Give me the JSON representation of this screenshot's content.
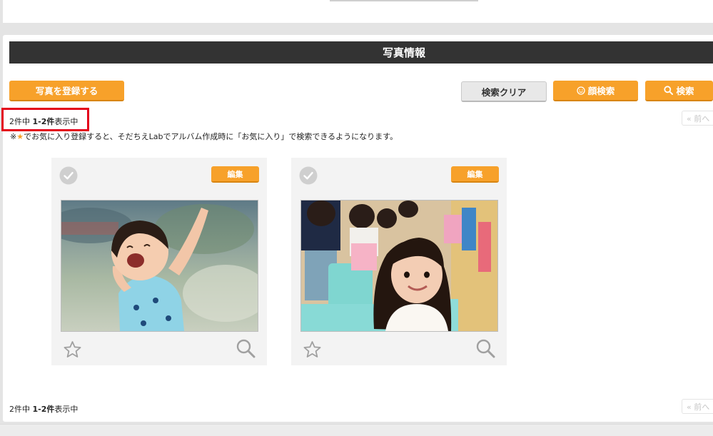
{
  "section": {
    "title": "写真情報"
  },
  "toolbar": {
    "register_label": "写真を登録する",
    "clear_label": "検索クリア",
    "face_search_label": "顔検索",
    "search_label": "検索"
  },
  "count_top": {
    "total": "2件中",
    "range": "1-2件",
    "suffix": "表示中"
  },
  "count_bottom": {
    "total": "2件中",
    "range": "1-2件",
    "suffix": "表示中"
  },
  "pager": {
    "prev_label": "« 前へ"
  },
  "notice": {
    "prefix": "※",
    "text": "でお気に入り登録すると、そだちえLabでアルバム作成時に「お気に入り」で検索できるようになります。"
  },
  "photos": [
    {
      "edit_label": "編集",
      "subject": "toddler-laughing-park"
    },
    {
      "edit_label": "編集",
      "subject": "girl-smiling-playroom"
    }
  ],
  "colors": {
    "accent": "#f7a12a",
    "title_bar": "#333333",
    "highlight": "#e3001b"
  },
  "icons": [
    "check-circle-icon",
    "star-outline-icon",
    "magnifier-icon",
    "smiley-icon",
    "search-icon",
    "double-chevron-left-icon"
  ]
}
